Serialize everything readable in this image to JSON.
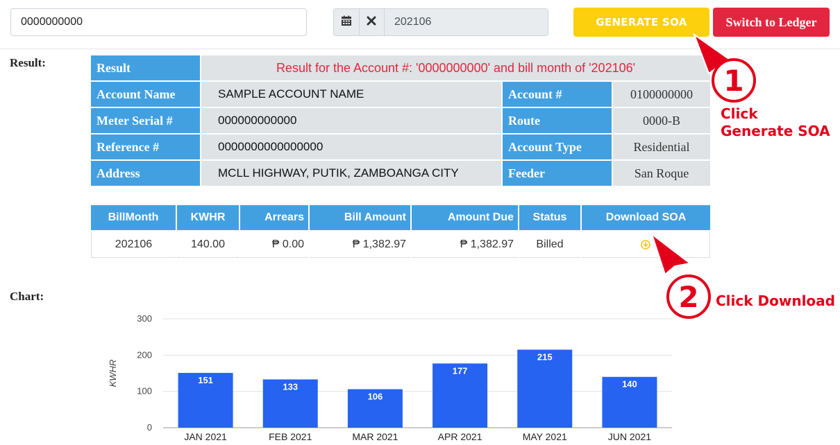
{
  "search": {
    "account_value": "0000000000"
  },
  "date_filter": {
    "calendar_icon": "calendar-icon",
    "clear_icon": "close-icon",
    "month_value": "202106"
  },
  "buttons": {
    "generate": "GENERATE SOA",
    "ledger": "Switch to Ledger"
  },
  "colors": {
    "primary": "#42a0e1",
    "generate": "#fdd00e",
    "ledger": "#e3263f",
    "bar": "#2563f0",
    "annotation": "#e3001b"
  },
  "result_section": {
    "label": "Result:",
    "header": "Result",
    "message": "Result for the Account #: '0000000000' and bill month of '202106'",
    "rows": [
      {
        "label": "Account Name",
        "value": "SAMPLE ACCOUNT NAME",
        "label2": "Account #",
        "value2": "0100000000"
      },
      {
        "label": "Meter Serial #",
        "value": "000000000000",
        "label2": "Route",
        "value2": "0000-B"
      },
      {
        "label": "Reference #",
        "value": "0000000000000000",
        "label2": "Account Type",
        "value2": "Residential"
      },
      {
        "label": "Address",
        "value": "MCLL HIGHWAY, PUTIK, ZAMBOANGA CITY",
        "label2": "Feeder",
        "value2": "San Roque"
      }
    ]
  },
  "bill_table": {
    "headers": [
      "BillMonth",
      "KWHR",
      "Arrears",
      "Bill Amount",
      "Amount Due",
      "Status",
      "Download SOA"
    ],
    "rows": [
      {
        "bill_month": "202106",
        "kwhr": "140.00",
        "arrears": "₱ 0.00",
        "bill_amount": "₱ 1,382.97",
        "amount_due": "₱ 1,382.97",
        "status": "Billed",
        "download_icon": "download-icon"
      }
    ]
  },
  "annotations": {
    "step1_number": "1",
    "step1_line1": "Click",
    "step1_line2": "Generate SOA",
    "step2_number": "2",
    "step2_text": "Click Download"
  },
  "chart_section": {
    "label": "Chart:"
  },
  "chart_data": {
    "type": "bar",
    "categories": [
      "JAN 2021",
      "FEB 2021",
      "MAR 2021",
      "APR 2021",
      "MAY 2021",
      "JUN 2021"
    ],
    "values": [
      151,
      133,
      106,
      177,
      215,
      140
    ],
    "ylabel": "KWHR",
    "ylim": [
      0,
      300
    ],
    "yticks": [
      0,
      100,
      200,
      300
    ],
    "grid": true
  }
}
